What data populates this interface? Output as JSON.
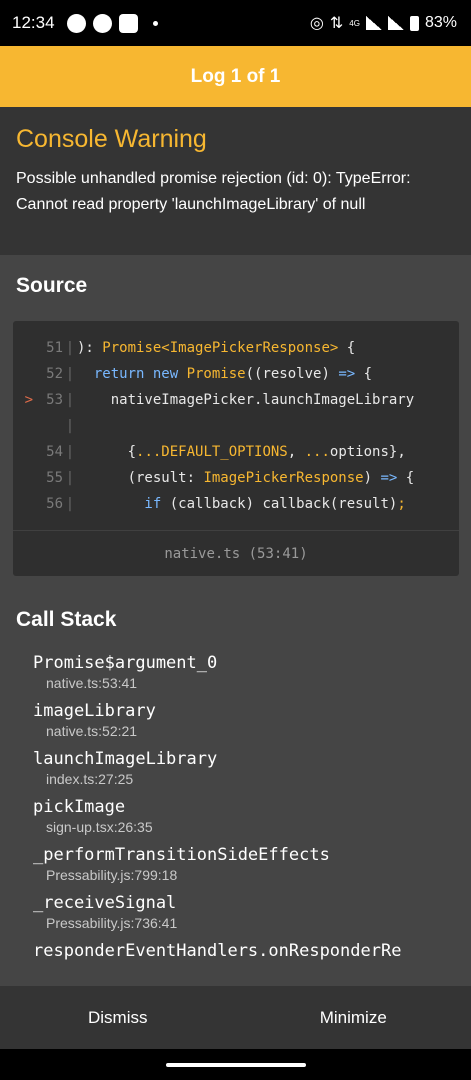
{
  "status_bar": {
    "time": "12:34",
    "network": "4G",
    "battery": "83%",
    "icons": [
      "whatsapp-icon",
      "message-icon",
      "app-icon",
      "notification-dot",
      "hotspot-icon",
      "data-arrows-icon",
      "signal-icon",
      "signal-icon",
      "battery-icon"
    ]
  },
  "header": {
    "title": "Log 1 of 1"
  },
  "warning": {
    "title": "Console Warning",
    "message": "Possible unhandled promise rejection (id: 0): TypeError: Cannot read property 'launchImageLibrary' of null"
  },
  "source": {
    "title": "Source",
    "lines": [
      {
        "marker": "",
        "number": "51",
        "tokens": [
          {
            "t": "): ",
            "c": "pl"
          },
          {
            "t": "Promise<ImagePickerResponse>",
            "c": "ty"
          },
          {
            "t": " {",
            "c": "pl"
          }
        ]
      },
      {
        "marker": "",
        "number": "52",
        "tokens": [
          {
            "t": "  return new ",
            "c": "kw"
          },
          {
            "t": "Promise",
            "c": "ty"
          },
          {
            "t": "((resolve) ",
            "c": "pl"
          },
          {
            "t": "=>",
            "c": "kw"
          },
          {
            "t": " {",
            "c": "pl"
          }
        ]
      },
      {
        "marker": ">",
        "number": "53",
        "tokens": [
          {
            "t": "    nativeImagePicker.launchImageLibrary",
            "c": "pl"
          }
        ]
      },
      {
        "marker": "",
        "number": "",
        "tokens": []
      },
      {
        "marker": "",
        "number": "54",
        "tokens": [
          {
            "t": "      {",
            "c": "pl"
          },
          {
            "t": "...DEFAULT_OPTIONS",
            "c": "ty"
          },
          {
            "t": ", ",
            "c": "pl"
          },
          {
            "t": "...",
            "c": "ty"
          },
          {
            "t": "options},",
            "c": "pl"
          }
        ]
      },
      {
        "marker": "",
        "number": "55",
        "tokens": [
          {
            "t": "      (result: ",
            "c": "pl"
          },
          {
            "t": "ImagePickerResponse",
            "c": "ty"
          },
          {
            "t": ") ",
            "c": "pl"
          },
          {
            "t": "=>",
            "c": "kw"
          },
          {
            "t": " {",
            "c": "pl"
          }
        ]
      },
      {
        "marker": "",
        "number": "56",
        "tokens": [
          {
            "t": "        if",
            "c": "kw"
          },
          {
            "t": " (callback) callback(result)",
            "c": "pl"
          },
          {
            "t": ";",
            "c": "ty"
          }
        ]
      }
    ],
    "file": "native.ts (53:41)"
  },
  "call_stack": {
    "title": "Call Stack",
    "frames": [
      {
        "name": "Promise$argument_0",
        "location": "native.ts:53:41"
      },
      {
        "name": "imageLibrary",
        "location": "native.ts:52:21"
      },
      {
        "name": "launchImageLibrary",
        "location": "index.ts:27:25"
      },
      {
        "name": "pickImage",
        "location": "sign-up.tsx:26:35"
      },
      {
        "name": "_performTransitionSideEffects",
        "location": "Pressability.js:799:18"
      },
      {
        "name": "_receiveSignal",
        "location": "Pressability.js:736:41"
      },
      {
        "name": "responderEventHandlers.onResponderRe",
        "location": ""
      }
    ]
  },
  "footer": {
    "dismiss_label": "Dismiss",
    "minimize_label": "Minimize"
  },
  "colors": {
    "accent": "#f7b731",
    "background": "#454545",
    "panel": "#343434",
    "code_bg": "#2f2f2f",
    "keyword": "#79b8ff"
  }
}
